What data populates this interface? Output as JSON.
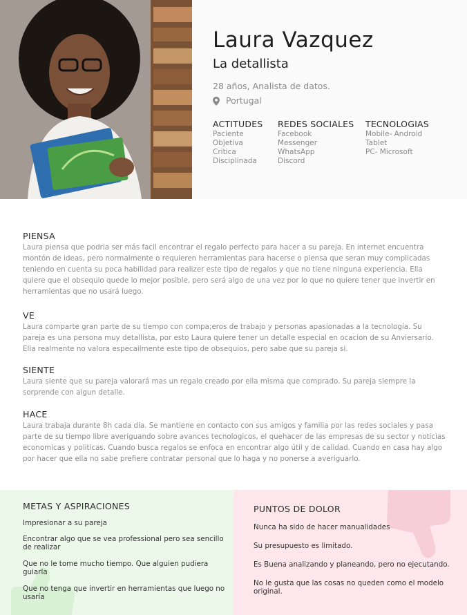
{
  "header": {
    "name": "Laura Vazquez",
    "role": "La detallista",
    "meta": "28 años, Analista de datos.",
    "location": "Portugal",
    "columns": [
      {
        "title": "ACTITUDES",
        "items": [
          "Paciente",
          "Objetiva",
          "Critica",
          "Disciplinada"
        ]
      },
      {
        "title": "REDES SOCIALES",
        "items": [
          "Facebook",
          "Messenger",
          "WhatsApp",
          "Discord"
        ]
      },
      {
        "title": "TECNOLOGIAS",
        "items": [
          "Mobile- Android",
          "Tablet",
          "PC- Microsoft"
        ]
      }
    ]
  },
  "sections": {
    "piensa": {
      "title": "PIENSA",
      "text": "Laura piensa que podria ser más facil encontrar el regalo perfecto para hacer a su pareja. En internet encuentra montón de ideas, pero normalmente o requieren herramientas para hacerse o piensa que seran muy complicadas teniendo en cuenta su poca habilidad para realizer este tipo de regalos y que no tiene ninguna experiencia. Ella quiere que el obsequio quede lo mejor posible, pero será algo de una vez por lo que no quiere tener que invertir en herramientas que no usará luego."
    },
    "ve": {
      "title": "VE",
      "text": "Laura comparte gran parte de su tiempo con compa;eros de trabajo y personas apasionadas a la tecnología. Su pareja es una persona muy detallista, por esto Laura quiere tener un detalle especial en ocacion de su Anviersario. Ella realmente no valora especailmente este tipo de obsequios, pero sabe que su pareja si."
    },
    "siente": {
      "title": "SIENTE",
      "text": "Laura siente que su pareja valorará mas un regalo creado por ella misma que comprado. Su pareja siempre la sorprende con algun detalle."
    },
    "hace": {
      "title": "HACE",
      "text": "Laura trabaja durante 8h cada dia. Se mantiene en contacto con sus amigos y familia por las redes sociales y pasa parte de su tiempo libre averiguando sobre avances tecnologicos, el quehacer de las empresas de su sector  y noticias economicas y politicas. Cuando busca regalos se enfoca en encontrar algo útil y de calidad. Cuando en casa hay algo por hacer que ella no sabe prefiere contratar personal que lo haga y no ponerse a averiguarlo."
    }
  },
  "goals": {
    "title": "METAS Y ASPIRACIONES",
    "items": [
      "Impresionar a su pareja",
      "Encontrar algo que se vea professional pero sea sencillo de realizar",
      "Que no le tome mucho tiempo. Que alguien pudiera guiarla",
      "Que no tenga que invertir en herramientas que luego no usaría"
    ]
  },
  "pains": {
    "title": "PUNTOS DE DOLOR",
    "items": [
      "Nunca ha sido de hacer manualidades",
      "Su presupuesto es limitado.",
      "Es Buena analizando y planeando, pero no ejecutando.",
      "No le gusta que las cosas no queden como el modelo original."
    ]
  },
  "colors": {
    "goals_bg": "#ecf8ea",
    "pains_bg": "#fde6ec",
    "heading": "#2a2a2a",
    "body_text": "#8a8a8a"
  },
  "icons": [
    "map-pin-icon",
    "thumbs-up-icon",
    "thumbs-down-icon"
  ]
}
